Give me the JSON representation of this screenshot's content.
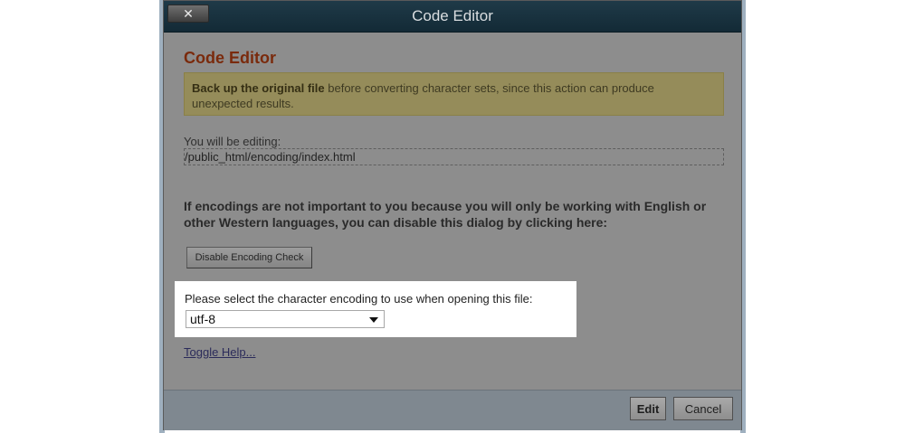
{
  "window": {
    "title": "Code Editor",
    "close_label": "✕"
  },
  "main": {
    "heading": "Code Editor",
    "warning_bold": "Back up the original file",
    "warning_rest": " before converting character sets, since this action can produce unexpected results.",
    "editing_label": "You will be editing:",
    "file_path": "/public_html/encoding/index.html",
    "encoding_note": "If encodings are not important to you because you will only be working with English or other Western languages, you can disable this dialog by clicking here:",
    "disable_button": "Disable Encoding Check",
    "select_label": "Please select the character encoding to use when opening this file:",
    "encoding_selected": "utf-8",
    "toggle_help": "Toggle Help..."
  },
  "footer": {
    "edit_button": "Edit",
    "cancel_button": "Cancel"
  }
}
